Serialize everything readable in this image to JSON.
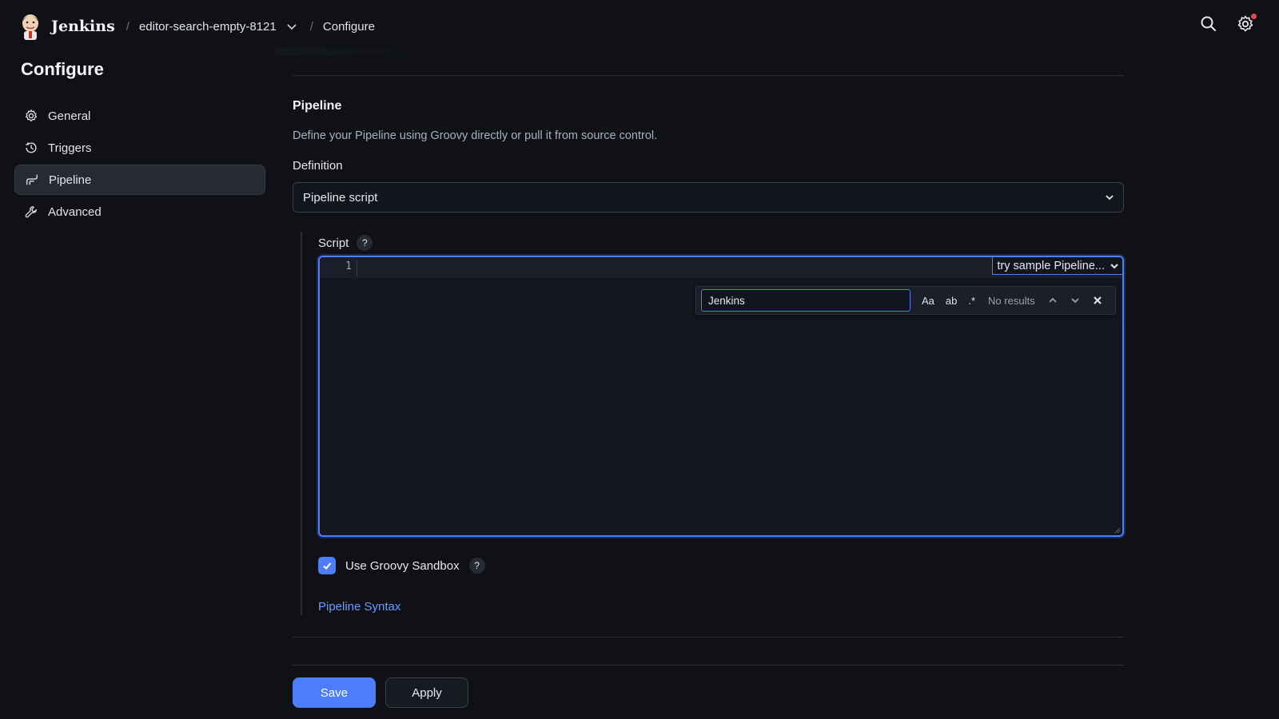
{
  "header": {
    "brand": "Jenkins",
    "breadcrumbs": [
      {
        "label": "editor-search-empty-8121"
      },
      {
        "label": "Configure"
      }
    ]
  },
  "sidebar": {
    "title": "Configure",
    "items": [
      {
        "label": "General",
        "icon": "gear-icon"
      },
      {
        "label": "Triggers",
        "icon": "clock-icon"
      },
      {
        "label": "Pipeline",
        "icon": "pipeline-icon",
        "active": true
      },
      {
        "label": "Advanced",
        "icon": "wrench-icon"
      }
    ]
  },
  "main": {
    "section_title": "Pipeline",
    "section_desc": "Define your Pipeline using Groovy directly or pull it from source control.",
    "definition_label": "Definition",
    "definition_value": "Pipeline script",
    "script_label": "Script",
    "help": "?",
    "editor": {
      "line_number": "1",
      "sample_select": "try sample Pipeline...",
      "find": {
        "query": "Jenkins",
        "opt_case": "Aa",
        "opt_word": "ab",
        "opt_regex": ".*",
        "status": "No results"
      }
    },
    "sandbox_label": "Use Groovy Sandbox",
    "sandbox_checked": true,
    "syntax_link": "Pipeline Syntax"
  },
  "footer": {
    "save": "Save",
    "apply": "Apply"
  },
  "colors": {
    "accent": "#4c7dfa",
    "background": "#0f1117",
    "notification": "#e5484d"
  }
}
